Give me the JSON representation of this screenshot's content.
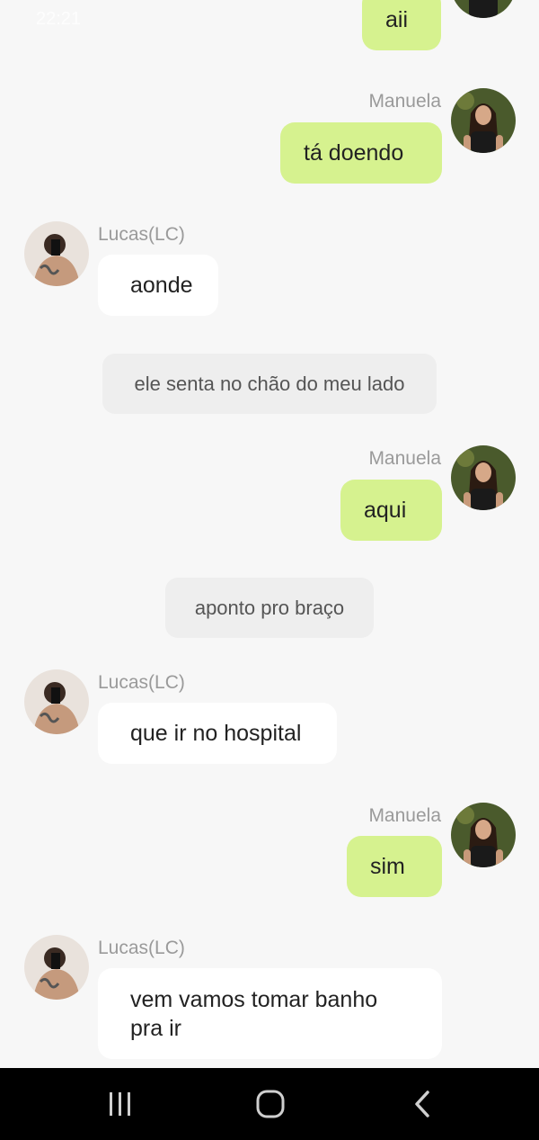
{
  "status_bar": {
    "time": "22:21",
    "right_text": ""
  },
  "participants": {
    "me": "Manuela",
    "other": "Lucas(LC)"
  },
  "messages": [
    {
      "text": "aii"
    },
    {
      "sender": "Manuela",
      "text": "tá doendo"
    },
    {
      "sender": "Lucas(LC)",
      "text": "aonde"
    },
    {
      "narration": "ele senta no chão do meu lado"
    },
    {
      "sender": "Manuela",
      "text": "aqui"
    },
    {
      "narration": "aponto pro braço"
    },
    {
      "sender": "Lucas(LC)",
      "text": "que ir no hospital"
    },
    {
      "sender": "Manuela",
      "text": "sim"
    },
    {
      "sender": "Lucas(LC)",
      "text": "vem vamos tomar banho pra ir"
    }
  ],
  "nav": {
    "icons": [
      "recent-apps-icon",
      "home-icon",
      "back-icon"
    ]
  }
}
